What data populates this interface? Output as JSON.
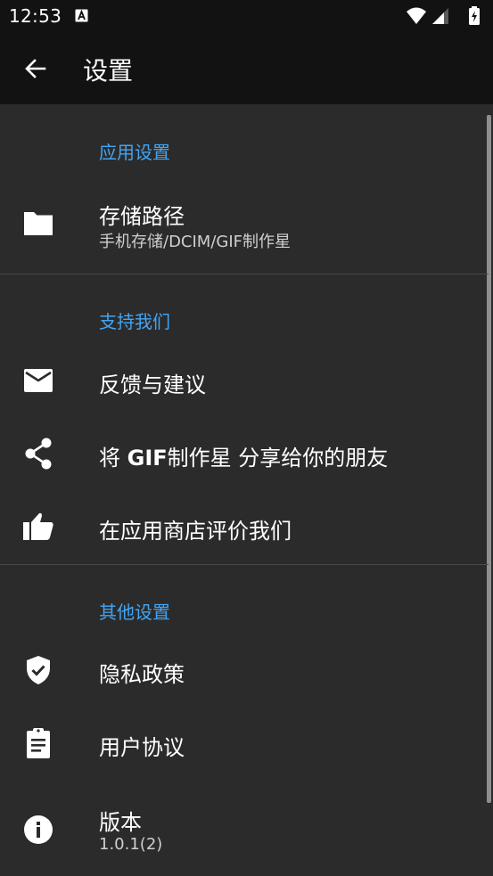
{
  "status_bar": {
    "time": "12:53",
    "notification_icon": "a-keyboard-icon",
    "wifi_icon": "wifi-icon",
    "signal_icon": "signal-icon",
    "battery_icon": "battery-charging-icon"
  },
  "app_bar": {
    "back_icon": "arrow-back-icon",
    "title": "设置"
  },
  "colors": {
    "accent": "#42a5f5",
    "background": "#2b2b2b",
    "toolbar": "#121212"
  },
  "sections": {
    "app_settings": {
      "header": "应用设置",
      "storage": {
        "title": "存储路径",
        "summary": "手机存储/DCIM/GIF制作星",
        "icon": "folder-icon"
      }
    },
    "support": {
      "header": "支持我们",
      "feedback": {
        "title": "反馈与建议",
        "icon": "mail-icon"
      },
      "share": {
        "title_prefix": "将 ",
        "title_bold": "GIF",
        "title_suffix": "制作星 分享给你的朋友",
        "icon": "share-icon"
      },
      "rate": {
        "title": "在应用商店评价我们",
        "icon": "thumb-up-icon"
      }
    },
    "other": {
      "header": "其他设置",
      "privacy": {
        "title": "隐私政策",
        "icon": "shield-check-icon"
      },
      "agreement": {
        "title": "用户协议",
        "icon": "clipboard-icon"
      },
      "version": {
        "title": "版本",
        "summary": "1.0.1(2)",
        "icon": "info-icon"
      }
    }
  }
}
